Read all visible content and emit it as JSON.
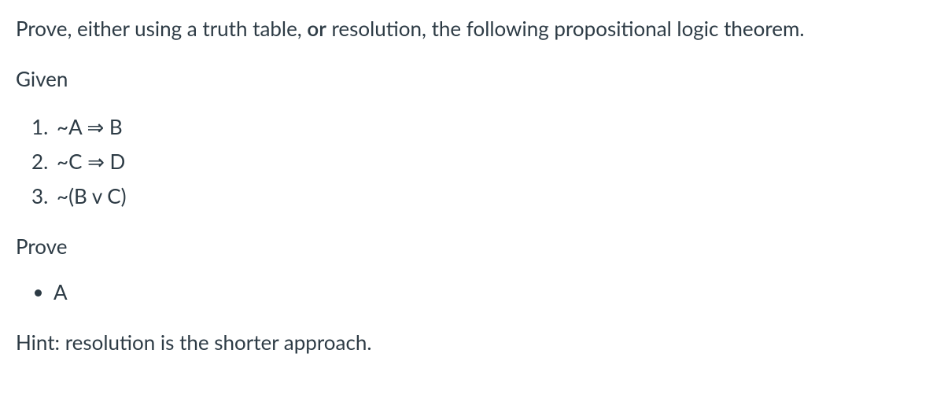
{
  "intro_pre": "Prove, either using a truth table, ",
  "intro_or": "or",
  "intro_post": " resolution, the following propositional logic theorem.",
  "given_label": "Given",
  "premises": [
    {
      "num": "1.",
      "text": "~A ⇒ B"
    },
    {
      "num": "2.",
      "text": "~C ⇒ D"
    },
    {
      "num": "3.",
      "text": "~(B v C)"
    }
  ],
  "prove_label": "Prove",
  "goals": [
    {
      "text": "A"
    }
  ],
  "hint": "Hint: resolution is the shorter approach."
}
